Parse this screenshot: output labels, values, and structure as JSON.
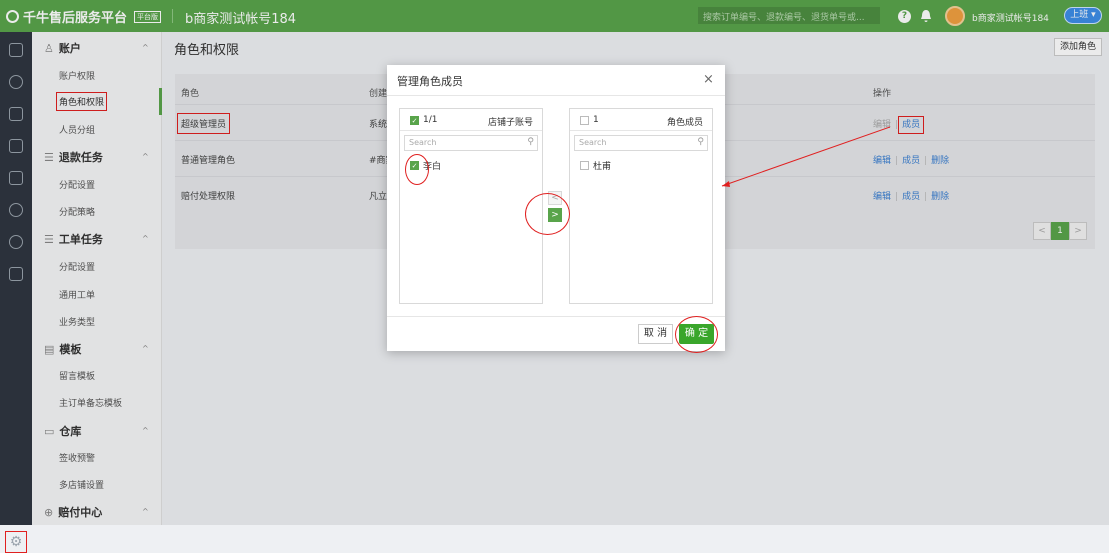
{
  "header": {
    "app_title": "千牛售后服务平台",
    "version_badge": "平台版",
    "account_name": "b商家测试帐号184",
    "search_placeholder": "搜索订单编号、退款编号、退货单号或...",
    "user_label": "b商家测试帐号184",
    "online_label": "上班"
  },
  "sidebar": {
    "sections": [
      {
        "title": "账户",
        "items": [
          "账户权限",
          "角色和权限",
          "人员分组"
        ]
      },
      {
        "title": "退款任务",
        "items": [
          "分配设置",
          "分配策略"
        ]
      },
      {
        "title": "工单任务",
        "items": [
          "分配设置",
          "通用工单",
          "业务类型"
        ]
      },
      {
        "title": "模板",
        "items": [
          "留言模板",
          "主订单备忘模板"
        ]
      },
      {
        "title": "仓库",
        "items": [
          "签收预警",
          "多店铺设置"
        ]
      },
      {
        "title": "赔付中心",
        "items": []
      }
    ]
  },
  "page": {
    "title": "角色和权限",
    "add_role_label": "添加角色",
    "table": {
      "headers": [
        "角色",
        "创建",
        "操作"
      ],
      "rows": [
        {
          "role": "超级管理员",
          "desc": "系统",
          "ops": [
            "编辑",
            "成员"
          ]
        },
        {
          "role": "普通管理角色",
          "desc": "#商家",
          "ops": [
            "编辑",
            "成员",
            "删除"
          ]
        },
        {
          "role": "赔付处理权限",
          "desc": "凡立",
          "ops": [
            "编辑",
            "成员",
            "删除"
          ]
        }
      ]
    },
    "pager": {
      "prev": "<",
      "current": "1",
      "next": ">"
    }
  },
  "modal": {
    "title": "管理角色成员",
    "close": "×",
    "left": {
      "count": "1/1",
      "title": "店铺子账号",
      "search_placeholder": "Search",
      "items": [
        "李白"
      ]
    },
    "right": {
      "count": "1",
      "title": "角色成员",
      "search_placeholder": "Search",
      "items": [
        "杜甫"
      ]
    },
    "move_left": "<",
    "move_right": ">",
    "cancel_label": "取 消",
    "ok_label": "确 定"
  }
}
